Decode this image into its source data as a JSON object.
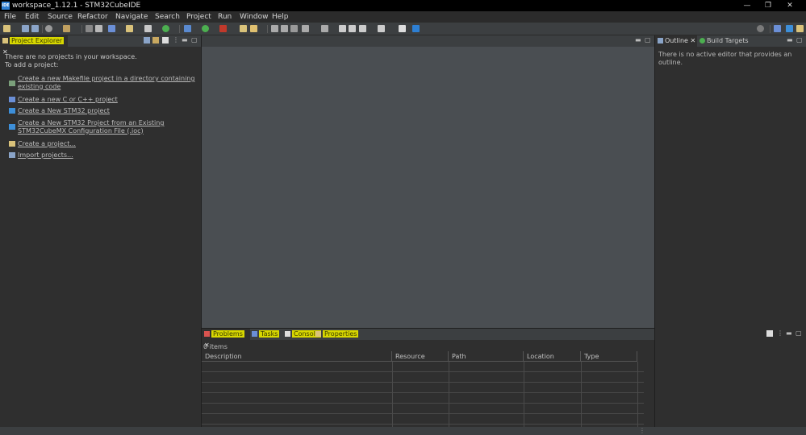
{
  "window": {
    "title": "workspace_1.12.1 - STM32CubeIDE",
    "app_icon_text": "IDE",
    "controls": [
      "—",
      "❐",
      "✕"
    ]
  },
  "menu": [
    "File",
    "Edit",
    "Source",
    "Refactor",
    "Navigate",
    "Search",
    "Project",
    "Run",
    "Window",
    "Help"
  ],
  "explorer": {
    "tab_label": "Project Explorer",
    "empty_line1": "There are no projects in your workspace.",
    "empty_line2": "To add a project:",
    "links": [
      {
        "line1": "Create a new Makefile project in a directory containing",
        "line2": "existing code"
      },
      {
        "line1": "Create a new C or C++ project",
        "line2": ""
      },
      {
        "line1": "Create a New STM32 project",
        "line2": ""
      },
      {
        "line1": "Create a New STM32 Project from an Existing",
        "line2": "STM32CubeMX Configuration File (.ioc)"
      },
      {
        "line1": "Create a project...",
        "line2": ""
      },
      {
        "line1": "Import projects...",
        "line2": ""
      }
    ]
  },
  "outline": {
    "tab_outline": "Outline",
    "tab_build_targets": "Build Targets",
    "message": "There is no active editor that provides an outline."
  },
  "problems": {
    "tabs": [
      "Problems",
      "Tasks",
      "Console",
      "Properties"
    ],
    "count": "0 items",
    "columns": [
      "Description",
      "Resource",
      "Path",
      "Location",
      "Type"
    ]
  },
  "colors": {
    "accent_highlight": "#d8d800",
    "editor_bg": "#4a4e52",
    "panel_bg": "#2f2f2f"
  }
}
